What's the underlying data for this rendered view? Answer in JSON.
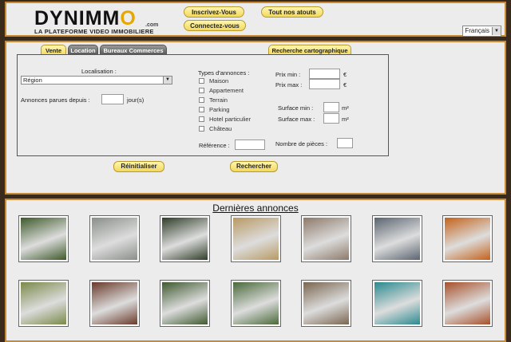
{
  "header": {
    "logo_brand_prefix": "DYNIMM",
    "logo_brand_o": "O",
    "logo_com": ".com",
    "logo_tagline": "LA PLATEFORME VIDEO IMMOBILIERE",
    "signup_label": "Inscrivez-Vous",
    "login_label": "Connectez-vous",
    "assets_label": "Tout nos atouts",
    "language": "Français"
  },
  "tabs": [
    {
      "label": "Vente"
    },
    {
      "label": "Location"
    },
    {
      "label": "Bureaux Commerces"
    }
  ],
  "map_search_label": "Recherche cartographique",
  "form": {
    "localisation_label": "Localisation :",
    "region_value": "Région",
    "published_since_label": "Annonces parues depuis :",
    "days_suffix": "jour(s)",
    "types_label": "Types d'annonces :",
    "types": [
      "Maison",
      "Appartement",
      "Terrain",
      "Parking",
      "Hotel particulier",
      "Château"
    ],
    "price_min_label": "Prix min :",
    "price_max_label": "Prix max :",
    "currency": "€",
    "surface_min_label": "Surface min :",
    "surface_max_label": "Surface max :",
    "surface_unit": "m²",
    "reference_label": "Référence :",
    "rooms_label": "Nombre de pièces :",
    "reset_label": "Réinitialiser",
    "search_label": "Rechercher"
  },
  "listings": {
    "title": "Dernières annonces",
    "colors": [
      [
        "#3d5a2a",
        "#8a8f8a",
        "#2f3d28",
        "#b89a64",
        "#8d7a6a",
        "#5a6470",
        "#c4621a"
      ],
      [
        "#7a8a4a",
        "#6a3a2a",
        "#3f5a30",
        "#4a6a3a",
        "#7a6650",
        "#2a8a8f",
        "#a8502a"
      ]
    ]
  }
}
